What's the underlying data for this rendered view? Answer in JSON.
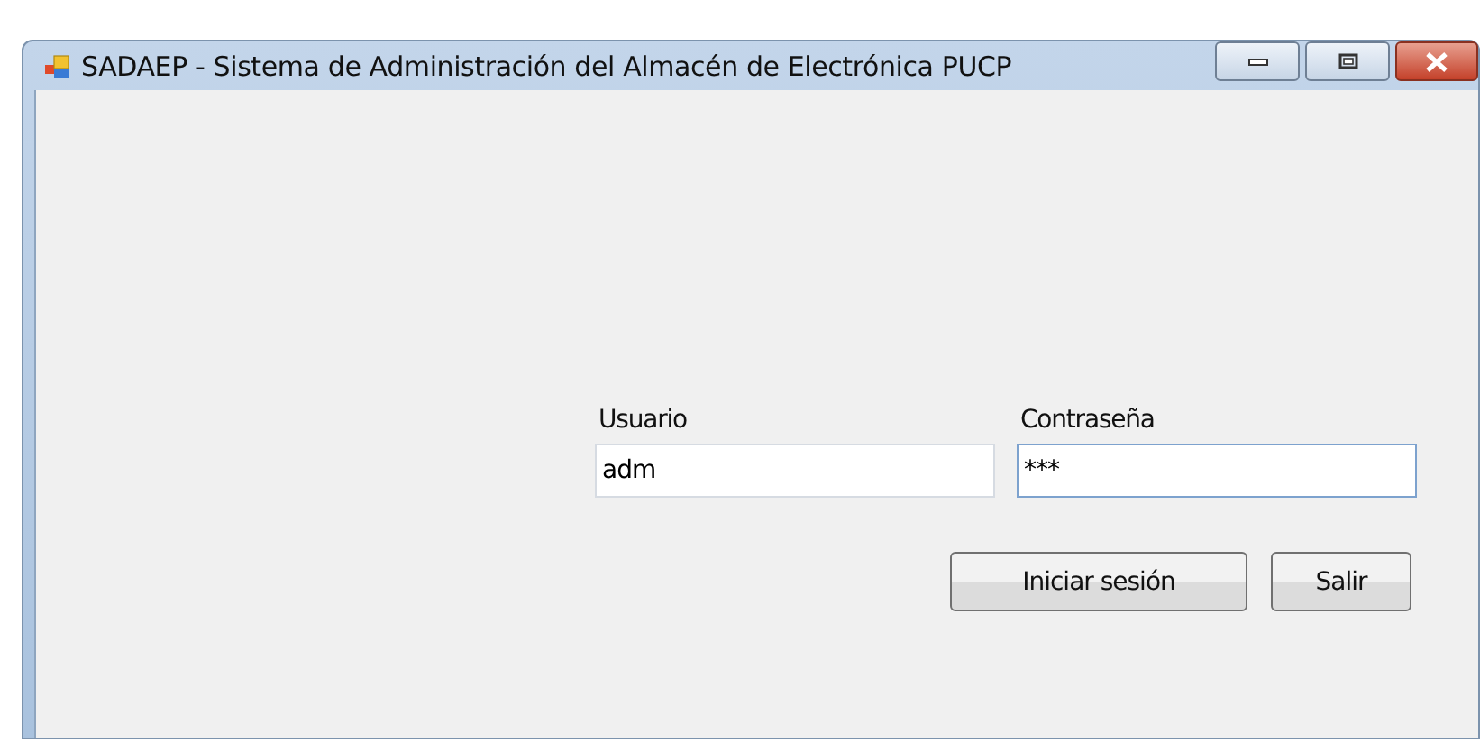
{
  "window": {
    "title": "SADAEP - Sistema de Administración del Almacén de Electrónica PUCP"
  },
  "fields": [
    {
      "label": "Usuario",
      "value": "adm",
      "focused": false
    },
    {
      "label": "Contraseña",
      "value": "***",
      "focused": true
    }
  ],
  "buttons": [
    "Iniciar sesión",
    "Salir"
  ]
}
